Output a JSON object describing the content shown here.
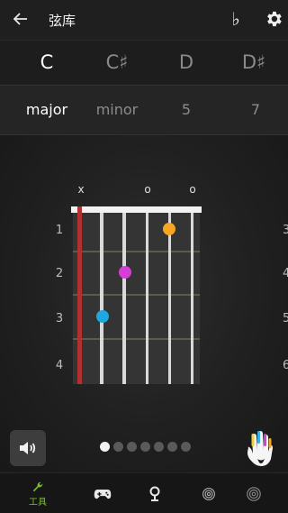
{
  "header": {
    "title": "弦库",
    "back_icon": "arrow-left-icon",
    "flat_label": "♭",
    "settings_icon": "gear-icon"
  },
  "roots": [
    "C",
    "C♯",
    "D",
    "D♯"
  ],
  "selected_root": "C",
  "qualities": [
    "major",
    "minor",
    "5",
    "7"
  ],
  "selected_quality": "major",
  "chord_diagram": {
    "string_markers": [
      "x",
      "",
      "",
      "o",
      "",
      "o"
    ],
    "fret_labels_left": [
      "1",
      "2",
      "3",
      "4"
    ],
    "fret_labels_right": [
      "3",
      "4",
      "5",
      "6"
    ],
    "fingers": [
      {
        "string": 5,
        "fret": 1,
        "color": "#f5a623"
      },
      {
        "string": 3,
        "fret": 2,
        "color": "#d43fd8"
      },
      {
        "string": 2,
        "fret": 3,
        "color": "#1ea8e0"
      }
    ],
    "muted_string_color": "#b33030"
  },
  "controls": {
    "sound_icon": "speaker-icon",
    "page_dots_count": 7,
    "page_active_index": 0,
    "hand_icon": "hand-icon"
  },
  "bottom_nav": {
    "items": [
      {
        "icon": "wrench-icon",
        "label": "工具",
        "active": true
      },
      {
        "icon": "gamepad-icon",
        "label": "",
        "active": false
      },
      {
        "icon": "location-pin-icon",
        "label": "",
        "active": false
      },
      {
        "icon": "fingerprint-icon",
        "label": "",
        "active": false
      }
    ],
    "active_color": "#7cbf2e"
  }
}
